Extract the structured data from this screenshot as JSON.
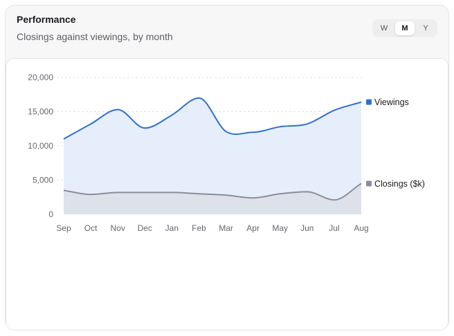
{
  "header": {
    "title": "Performance",
    "subtitle": "Closings against viewings, by month"
  },
  "period_toggle": {
    "options": [
      "W",
      "M",
      "Y"
    ],
    "selected": "M"
  },
  "chart_data": {
    "type": "area",
    "categories": [
      "Sep",
      "Oct",
      "Nov",
      "Dec",
      "Jan",
      "Feb",
      "Mar",
      "Apr",
      "May",
      "Jun",
      "Jul",
      "Aug"
    ],
    "series": [
      {
        "name": "Viewings",
        "color": "#2f6fd0",
        "fill": "#e6eefc",
        "values": [
          11000,
          13200,
          15300,
          12600,
          14500,
          17000,
          12100,
          12000,
          12800,
          13200,
          15200,
          16400
        ]
      },
      {
        "name": "Closings ($k)",
        "color": "#8a8d98",
        "fill": "#dce1ea",
        "values": [
          3500,
          2900,
          3200,
          3200,
          3200,
          3000,
          2800,
          2400,
          3000,
          3300,
          2100,
          4500
        ]
      }
    ],
    "yticks": [
      0,
      5000,
      10000,
      15000,
      20000
    ],
    "ytick_labels": [
      "0",
      "5,000",
      "10,000",
      "15,000",
      "20,000"
    ],
    "ylim": [
      0,
      20000
    ],
    "grid": true,
    "legend": "end-of-line labels",
    "title": "",
    "xlabel": "",
    "ylabel": ""
  }
}
